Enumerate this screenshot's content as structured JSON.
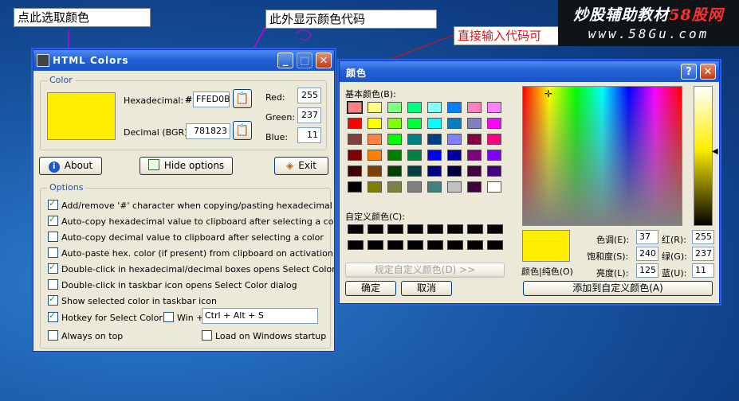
{
  "annotations": {
    "pick_color": "点此选取颜色",
    "show_code": "此外显示颜色代码",
    "input_code": "直接输入代码可"
  },
  "watermark": {
    "line1_a": "炒股辅助教材",
    "line1_b": "58股网",
    "line2": "www.58Gu.com"
  },
  "html_colors": {
    "title": "HTML Colors",
    "color_group": "Color",
    "swatch_color": "#ffee00",
    "hex_label": "Hexadecimal:",
    "hex_prefix": "#",
    "hex_value": "FFED0B",
    "dec_label": "Decimal (BGR):",
    "dec_value": "781823",
    "red_label": "Red:",
    "green_label": "Green:",
    "blue_label": "Blue:",
    "red_value": "255",
    "green_value": "237",
    "blue_value": "11",
    "about_button": "About",
    "hide_button": "Hide options",
    "exit_button": "Exit",
    "options_group": "Options",
    "options": [
      {
        "label": "Add/remove '#' character when copying/pasting hexadecimal value",
        "checked": true
      },
      {
        "label": "Auto-copy hexadecimal value to clipboard after selecting a color",
        "checked": true
      },
      {
        "label": "Auto-copy decimal value to clipboard after selecting a color",
        "checked": false
      },
      {
        "label": "Auto-paste hex. color (if present) from clipboard on activation",
        "checked": false
      },
      {
        "label": "Double-click in hexadecimal/decimal boxes opens Select Color dialog",
        "checked": true
      },
      {
        "label": "Double-click in taskbar icon opens Select Color dialog",
        "checked": false
      },
      {
        "label": "Show selected color in taskbar icon",
        "checked": true
      }
    ],
    "hotkey_label": "Hotkey for Select Color:",
    "win_label": "Win +",
    "hotkey_value": "Ctrl + Alt + S",
    "always_on_top": "Always on top",
    "load_startup": "Load on Windows startup"
  },
  "color_dialog": {
    "title": "颜色",
    "basic_label": "基本颜色(B):",
    "basic_colors": [
      "#ff8080",
      "#ffff80",
      "#80ff80",
      "#00ff80",
      "#80ffff",
      "#0080ff",
      "#ff80c0",
      "#ff80ff",
      "#ff0000",
      "#ffff00",
      "#80ff00",
      "#00ff40",
      "#00ffff",
      "#0080c0",
      "#8080c0",
      "#ff00ff",
      "#804040",
      "#ff8040",
      "#00ff00",
      "#008080",
      "#004080",
      "#8080ff",
      "#800040",
      "#ff0080",
      "#800000",
      "#ff8000",
      "#008000",
      "#008040",
      "#0000ff",
      "#0000a0",
      "#800080",
      "#8000ff",
      "#400000",
      "#804000",
      "#004000",
      "#004040",
      "#000080",
      "#000040",
      "#400040",
      "#400080",
      "#000000",
      "#808000",
      "#808040",
      "#808080",
      "#408080",
      "#c0c0c0",
      "#400040",
      "#ffffff"
    ],
    "custom_label": "自定义颜色(C):",
    "define_button": "规定自定义颜色(D) >>",
    "ok_button": "确定",
    "cancel_button": "取消",
    "color_solid_label": "颜色|纯色(O)",
    "hue_label": "色调(E):",
    "sat_label": "饱和度(S):",
    "lum_label": "亮度(L):",
    "red_label": "红(R):",
    "green_label": "绿(G):",
    "blue_label": "蓝(U):",
    "hue_value": "37",
    "sat_value": "240",
    "lum_value": "125",
    "red_value": "255",
    "green_value": "237",
    "blue_value": "11",
    "add_custom_button": "添加到自定义颜色(A)",
    "preview_color": "#ffee00",
    "help_button": "?",
    "close_button": "✕"
  }
}
